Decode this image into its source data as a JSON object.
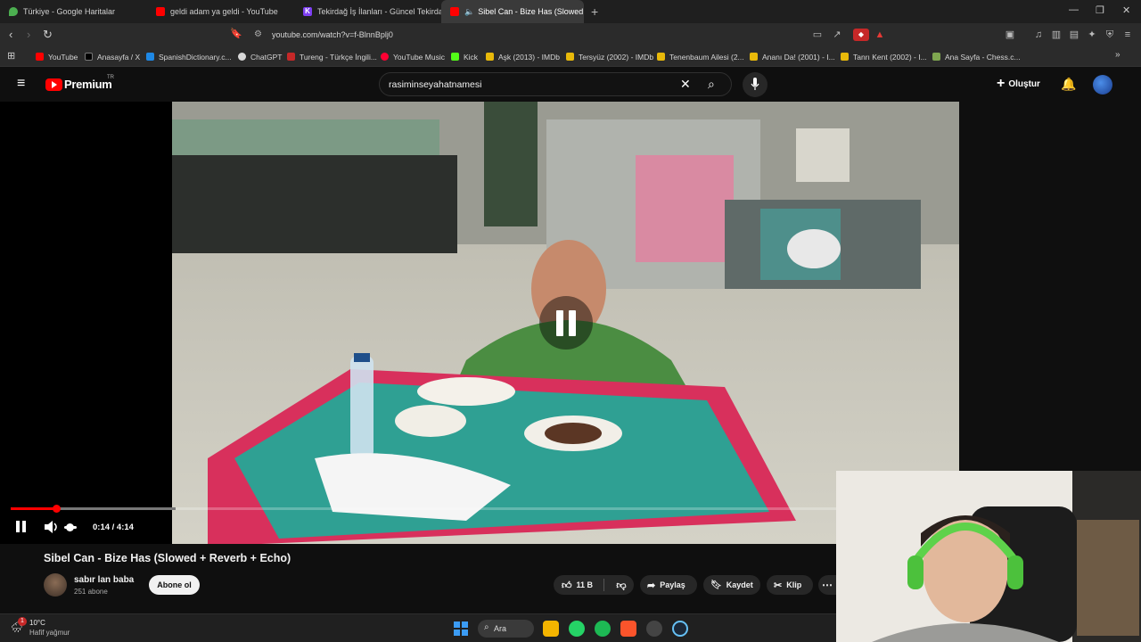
{
  "browser": {
    "tabs": [
      {
        "title": "Türkiye - Google Haritalar",
        "color": "#4caf50"
      },
      {
        "title": "geldi adam ya geldi - YouTube",
        "color": "#ff0000"
      },
      {
        "title": "Tekirdağ İş İlanları - Güncel Tekirdağ",
        "color": "#7e3ff2"
      },
      {
        "title": "Sibel Can - Bize Has (Slowed",
        "color": "#ff0000"
      }
    ],
    "url": "youtube.com/watch?v=f-BlnnBplj0",
    "bookmarks": [
      {
        "label": "YouTube",
        "color": "#ff0000"
      },
      {
        "label": "Anasayfa / X",
        "color": "#000000"
      },
      {
        "label": "SpanishDictionary.c...",
        "color": "#1e88e5"
      },
      {
        "label": "ChatGPT",
        "color": "#d8d8d8"
      },
      {
        "label": "Tureng - Türkçe İngili...",
        "color": "#c62828"
      },
      {
        "label": "YouTube Music",
        "color": "#ff0033"
      },
      {
        "label": "Kick",
        "color": "#53fc18"
      },
      {
        "label": "Aşk (2013) - IMDb",
        "color": "#e8b90a"
      },
      {
        "label": "Tersyüz (2002) - IMDb",
        "color": "#e8b90a"
      },
      {
        "label": "Tenenbaum Ailesi (2...",
        "color": "#e8b90a"
      },
      {
        "label": "Ananı Da! (2001) - I...",
        "color": "#e8b90a"
      },
      {
        "label": "Tanrı Kent (2002) - I...",
        "color": "#e8b90a"
      },
      {
        "label": "Ana Sayfa - Chess.c...",
        "color": "#7fa650"
      }
    ]
  },
  "youtube": {
    "logo_text": "Premium",
    "logo_region": "TR",
    "search_query": "rasiminseyahatnamesi",
    "create_label": "Oluştur",
    "player": {
      "time": "0:14 / 4:14",
      "progress": 0.055
    },
    "video": {
      "title": "Sibel Can - Bize Has (Slowed + Reverb + Echo)",
      "channel": "sabır lan baba",
      "subscribers": "251 abone",
      "subscribe_label": "Abone ol",
      "likes": "11 B",
      "share_label": "Paylaş",
      "save_label": "Kaydet",
      "clip_label": "Klip"
    }
  },
  "taskbar": {
    "weather_temp": "10°C",
    "weather_desc": "Hafif yağmur",
    "weather_badge": "1",
    "search_label": "Ara"
  },
  "colors": {
    "accent_red": "#ff0000",
    "progress_buffer": "#777777"
  }
}
